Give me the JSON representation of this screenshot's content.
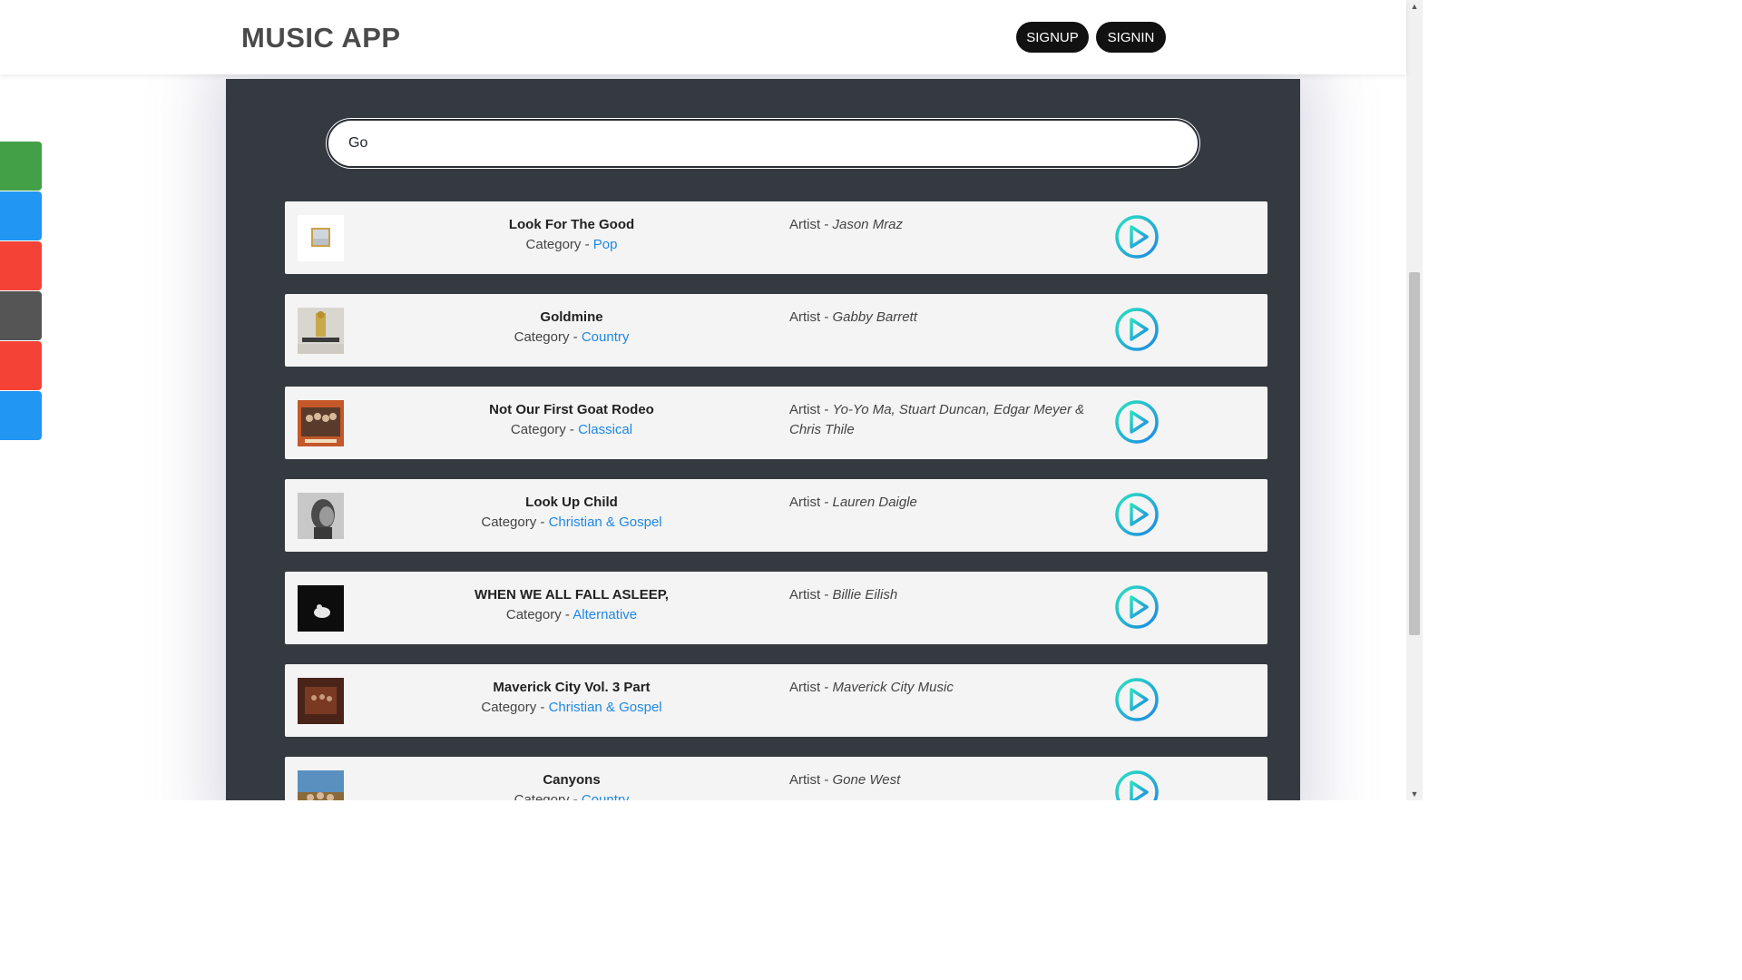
{
  "navbar": {
    "brand": "MUSIC APP",
    "signup_label": "SIGNUP",
    "signin_label": "SIGNIN"
  },
  "social_colors": [
    "#43a047",
    "#2196f3",
    "#f44336",
    "#555555",
    "#f44336",
    "#2196f3"
  ],
  "search": {
    "value": "Go"
  },
  "labels": {
    "category": "Category - ",
    "artist": "Artist - "
  },
  "accent_color": "#1e88e5",
  "songs": [
    {
      "title": "Look For The Good",
      "category": "Pop",
      "artist": "Jason Mraz"
    },
    {
      "title": "Goldmine",
      "category": "Country",
      "artist": "Gabby Barrett"
    },
    {
      "title": "Not Our First Goat Rodeo",
      "category": "Classical",
      "artist": "Yo-Yo Ma, Stuart Duncan, Edgar Meyer & Chris Thile"
    },
    {
      "title": "Look Up Child",
      "category": "Christian & Gospel",
      "artist": "Lauren Daigle"
    },
    {
      "title": "WHEN WE ALL FALL ASLEEP,",
      "category": "Alternative",
      "artist": "Billie Eilish"
    },
    {
      "title": "Maverick City Vol. 3 Part",
      "category": "Christian & Gospel",
      "artist": "Maverick City Music"
    },
    {
      "title": "Canyons",
      "category": "Country",
      "artist": "Gone West"
    }
  ]
}
